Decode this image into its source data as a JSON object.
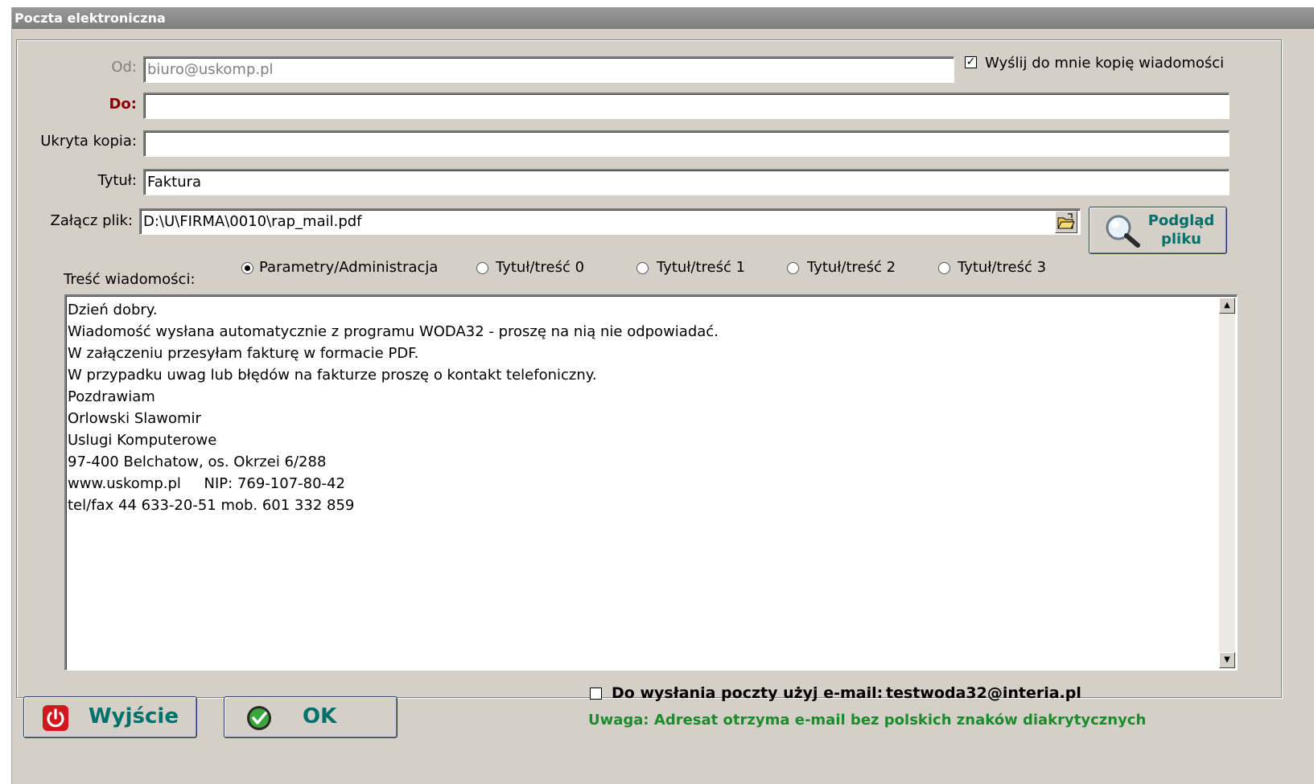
{
  "window": {
    "title": "Poczta elektroniczna"
  },
  "form": {
    "from_label": "Od:",
    "from_value": "biuro@uskomp.pl",
    "send_copy_label": "Wyślij do mnie kopię wiadomości",
    "send_copy_checked": true,
    "to_label": "Do:",
    "to_value": "",
    "bcc_label": "Ukryta kopia:",
    "bcc_value": "",
    "subject_label": "Tytuł:",
    "subject_value": "Faktura",
    "attach_label": "Załącz plik:",
    "attach_value": "D:\\U\\FIRMA\\0010\\rap_mail.pdf",
    "preview_label_1": "Podgląd",
    "preview_label_2": "pliku"
  },
  "body": {
    "label": "Treść wiadomości:",
    "templates": [
      {
        "label": "Parametry/Administracja",
        "selected": true
      },
      {
        "label": "Tytuł/treść 0",
        "selected": false
      },
      {
        "label": "Tytuł/treść 1",
        "selected": false
      },
      {
        "label": "Tytuł/treść 2",
        "selected": false
      },
      {
        "label": "Tytuł/treść 3",
        "selected": false
      }
    ],
    "text": "Dzień dobry.\nWiadomość wysłana automatycznie z programu WODA32 - proszę na nią nie odpowiadać.\nW załączeniu przesyłam fakturę w formacie PDF.\nW przypadku uwag lub błędów na fakturze proszę o kontakt telefoniczny.\nPozdrawiam\nOrlowski Slawomir\nUslugi Komputerowe\n97-400 Belchatow, os. Okrzei 6/288\nwww.uskomp.pl     NIP: 769-107-80-42\ntel/fax 44 633-20-51 mob. 601 332 859"
  },
  "footer": {
    "exit_label": "Wyjście",
    "ok_label": "OK",
    "use_email_label": "Do wysłania poczty użyj e-mail:",
    "use_email_value": "testwoda32@interia.pl",
    "use_email_checked": false,
    "warning": "Uwaga: Adresat otrzyma e-mail bez polskich znaków diakrytycznych"
  },
  "colors": {
    "accent_text": "#00706b",
    "required_label": "#8b0000",
    "warning": "#1d8a2c"
  }
}
